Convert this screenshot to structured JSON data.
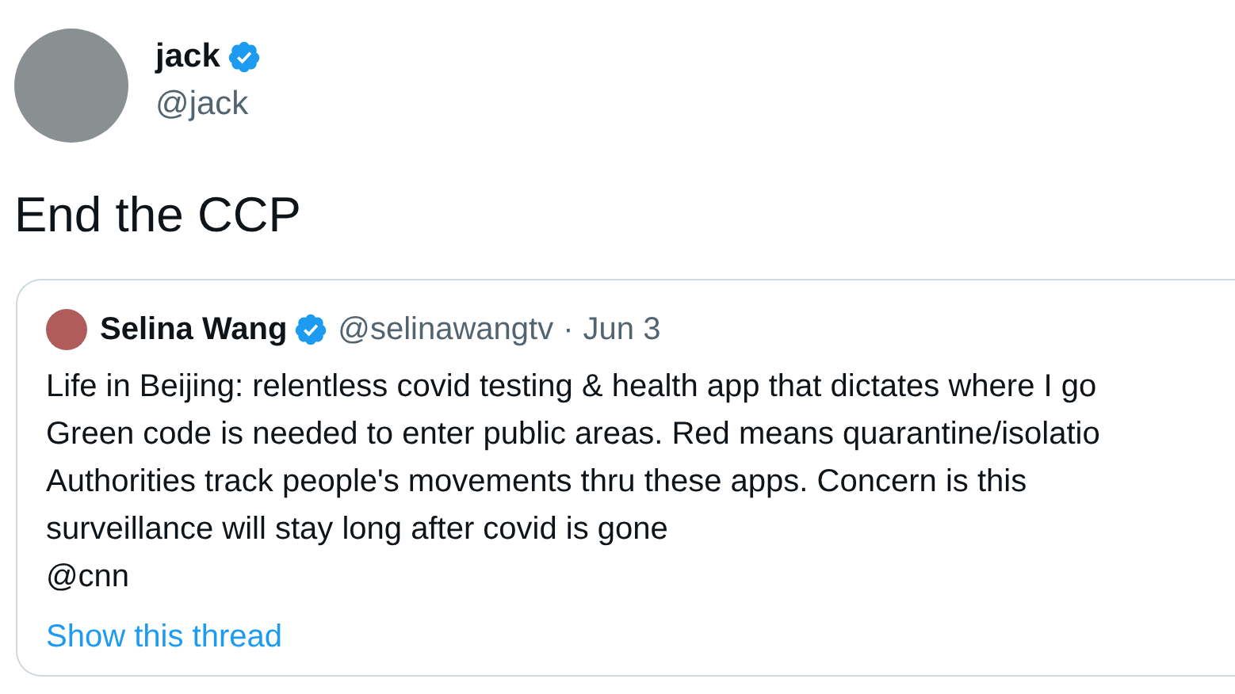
{
  "author": {
    "name": "jack",
    "verified": true,
    "handle": "@jack"
  },
  "tweet_text": "End the CCP",
  "quoted_tweet": {
    "author": {
      "name": "Selina Wang",
      "verified": true,
      "handle": "@selinawangtv",
      "separator": "·",
      "date": "Jun 3"
    },
    "lines": [
      "Life in Beijing: relentless covid testing & health app that dictates where I go",
      "Green code is needed to enter public areas. Red means quarantine/isolatio",
      "Authorities track people's movements thru these apps. Concern is this",
      "surveillance will stay long after covid is gone",
      "@cnn"
    ],
    "show_thread": "Show this thread"
  }
}
